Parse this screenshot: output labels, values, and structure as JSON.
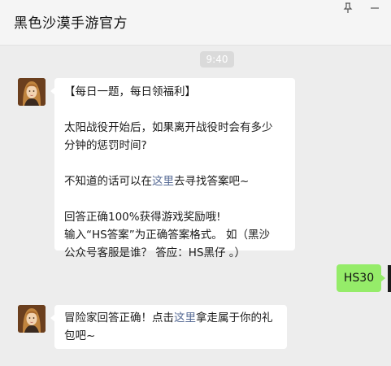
{
  "header": {
    "title": "黑色沙漠手游官方",
    "pin_icon": "pin-icon",
    "minimize_icon": "minimize-icon"
  },
  "timestamp": "9:40",
  "messages": [
    {
      "from": "official",
      "avatar": "game-avatar",
      "lines": {
        "l1": "【每日一题，每日领福利】",
        "l2": "太阳战役开始后，如果离开战役时会有多少",
        "l3": "分钟的惩罚时间?",
        "l4_pre": "不知道的话可以在",
        "l4_link": "这里",
        "l4_post": "去寻找答案吧~",
        "l5": "回答正确100%获得游戏奖励哦!",
        "l6": "输入“HS答案”为正确答案格式。 如（黑沙",
        "l7": "公众号客服是谁？ 答应：HS黑仔 。）"
      }
    },
    {
      "from": "user",
      "text": "HS30"
    },
    {
      "from": "official",
      "avatar": "game-avatar",
      "lines": {
        "l1_pre": "冒险家回答正确！点击",
        "l1_link": "这里",
        "l1_post": "拿走属于你的礼",
        "l2": "包吧~"
      }
    }
  ],
  "colors": {
    "background": "#ededed",
    "bubble_in": "#ffffff",
    "bubble_out": "#95ec69",
    "link": "#576b95"
  }
}
